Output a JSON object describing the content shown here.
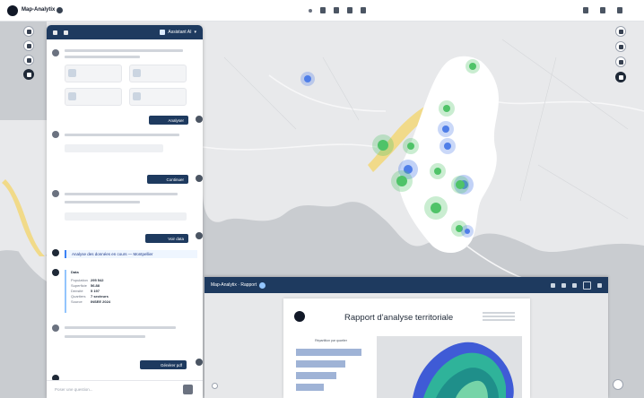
{
  "app": {
    "name": "Map-Analytix"
  },
  "panel": {
    "model_label": "Assistant AI"
  },
  "messages": {
    "actions": [
      "Analyser",
      "Continuer",
      "Voir data",
      "Générer pdf"
    ],
    "info_text": "Analyse des données en cours — Montpellier",
    "result_title": "Data",
    "result_rows": [
      {
        "k": "Population",
        "v": "295 542"
      },
      {
        "k": "Superficie",
        "v": "56.88"
      },
      {
        "k": "Densité",
        "v": "5 197"
      },
      {
        "k": "Quartiers",
        "v": "7 secteurs"
      },
      {
        "k": "Source",
        "v": "INSEE 2024"
      }
    ]
  },
  "composer": {
    "placeholder": "Poser une question..."
  },
  "report": {
    "window_title": "Map-Analytix · Rapport",
    "doc_title": "Rapport d'analyse territoriale",
    "chart_caption": "Répartition par quartier",
    "bar_fractions": [
      0.94,
      0.7,
      0.58,
      0.4
    ]
  },
  "colors": {
    "navy": "#1e3a5f",
    "green_cluster": "#4fc368",
    "blue_cluster": "#4f7ee8",
    "land": "#e8e9eb",
    "sea": "#c9ccd0",
    "beach": "#f1da89"
  },
  "icons": {
    "left_tools": [
      "layers-icon",
      "search-icon",
      "filter-icon",
      "globe-icon"
    ],
    "right_tools": [
      "compass-icon",
      "pen-icon",
      "settings-icon",
      "user-icon"
    ]
  }
}
